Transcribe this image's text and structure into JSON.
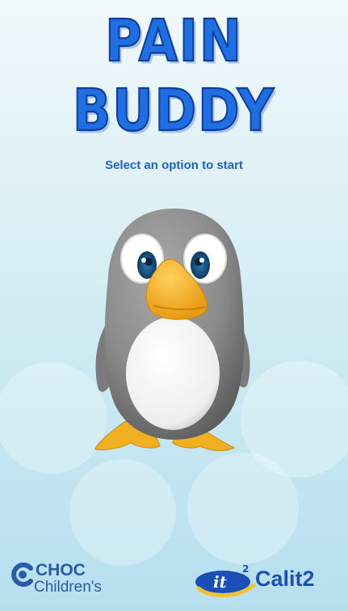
{
  "title": {
    "line1": "PAIN",
    "line2": "BUDDY"
  },
  "subtitle": "Select an option to start",
  "mascot": {
    "name": "penguin-mascot"
  },
  "logos": {
    "choc": {
      "line1": "CHOC",
      "line2": "Children's"
    },
    "calit2": {
      "emblem": "it",
      "superscript": "2",
      "name": "Calit2"
    }
  },
  "colors": {
    "title": "#1f6fe3",
    "subtitle": "#1e62c8",
    "background_top": "#f1f8fb",
    "background_bottom": "#b6dfee"
  }
}
